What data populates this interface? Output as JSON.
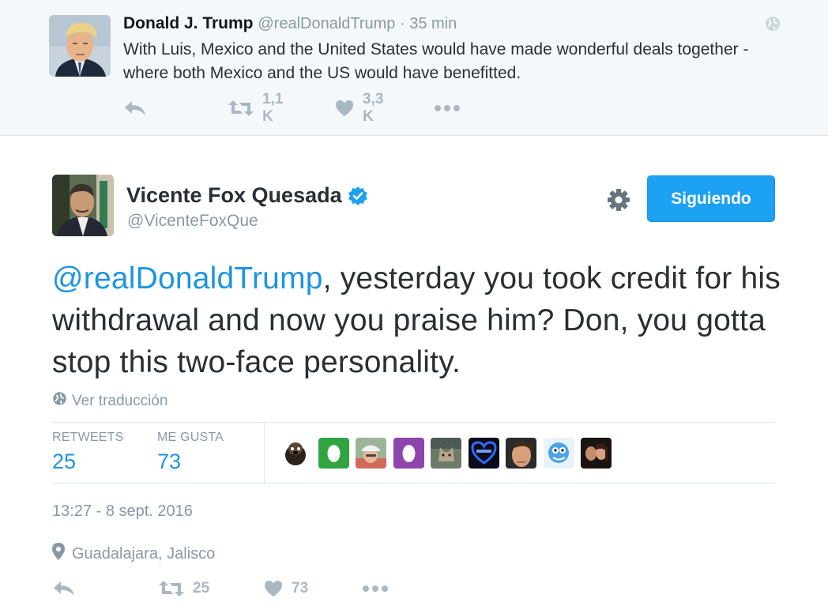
{
  "parent_tweet": {
    "author_name": "Donald J. Trump",
    "author_handle": "@realDonaldTrump",
    "separator": " · ",
    "time": "35 min",
    "text": "With Luis, Mexico and the United States would have made wonderful deals together - where both Mexico and the US would have benefitted.",
    "retweets": "1,1 K",
    "likes": "3,3 K",
    "icons": [
      "reply-icon",
      "retweet-icon",
      "heart-icon",
      "more-icon",
      "globe-icon"
    ]
  },
  "tweet": {
    "author_name": "Vicente Fox Quesada",
    "author_handle": "@VicenteFoxQue",
    "follow_label": "Siguiendo",
    "mention": "@realDonaldTrump",
    "text_rest": ", yesterday you took credit for his withdrawal and now you praise him? Don, you gotta stop this two-face personality.",
    "translate_label": "Ver traducción",
    "stats": {
      "retweets_label": "RETWEETS",
      "retweets_value": "25",
      "likes_label": "ME GUSTA",
      "likes_value": "73"
    },
    "timestamp": "13:27 - 8 sept. 2016",
    "location": "Guadalajara, Jalisco",
    "action_retweets": "25",
    "action_likes": "73",
    "liked_by_avatars": [
      "dog",
      "egg-green",
      "man-cap",
      "egg-purple",
      "cat",
      "heart-badge",
      "man-face",
      "cartoon",
      "couple"
    ]
  },
  "colors": {
    "link_blue": "#1b95e0",
    "button_blue": "#1da1f2",
    "muted_gray": "#8899a6",
    "icon_gray": "#aab8c2",
    "parent_bg": "#f5f8fa"
  }
}
